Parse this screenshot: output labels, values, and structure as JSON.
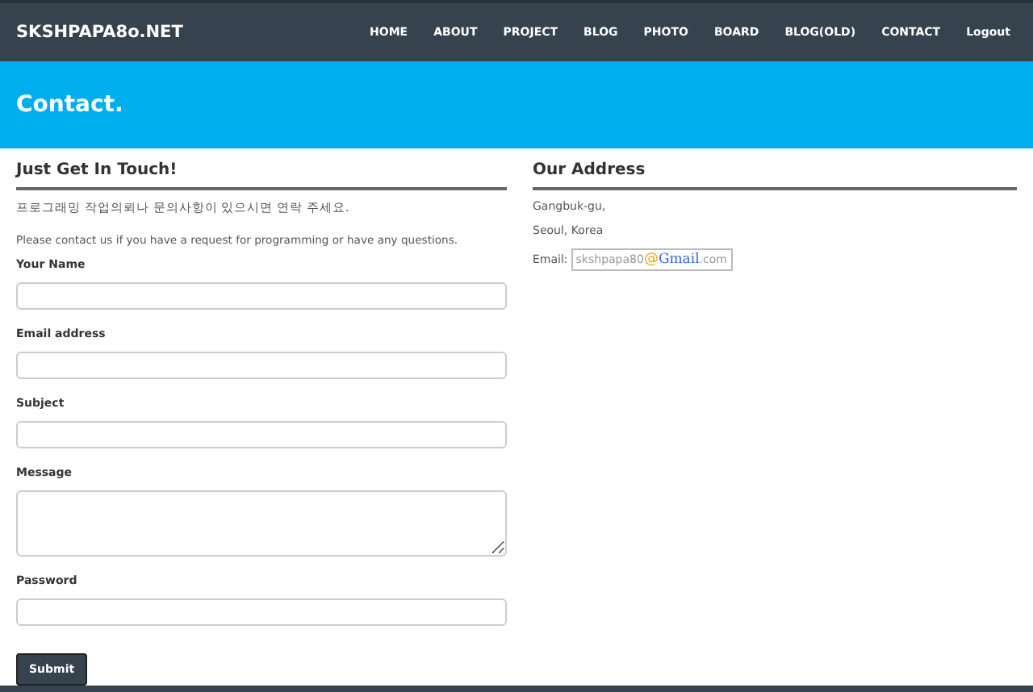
{
  "brand": "SKSHPAPA8o.NET",
  "nav": [
    {
      "label": "HOME"
    },
    {
      "label": "ABOUT"
    },
    {
      "label": "PROJECT"
    },
    {
      "label": "BLOG"
    },
    {
      "label": "PHOTO"
    },
    {
      "label": "BOARD"
    },
    {
      "label": "BLOG(OLD)"
    },
    {
      "label": "CONTACT"
    },
    {
      "label": "Logout"
    }
  ],
  "banner": {
    "title": "Contact."
  },
  "contact": {
    "heading": "Just Get In Touch!",
    "intro_ko": "프로그래밍 작업의뢰나 문의사항이 있으시면 연락 주세요.",
    "intro_en": "Please contact us if you have a request for programming or have any questions.",
    "fields": [
      {
        "label": "Your Name",
        "kind": "text"
      },
      {
        "label": "Email address",
        "kind": "text"
      },
      {
        "label": "Subject",
        "kind": "text"
      },
      {
        "label": "Message",
        "kind": "textarea"
      },
      {
        "label": "Password",
        "kind": "password"
      }
    ],
    "submit": "Submit"
  },
  "address": {
    "heading": "Our Address",
    "lines": [
      "Gangbuk-gu,",
      "Seoul, Korea"
    ],
    "email_label": "Email:",
    "email": {
      "user": "skshpapa80",
      "at": "@",
      "brand": "Gmail",
      "tld": ".com"
    }
  }
}
